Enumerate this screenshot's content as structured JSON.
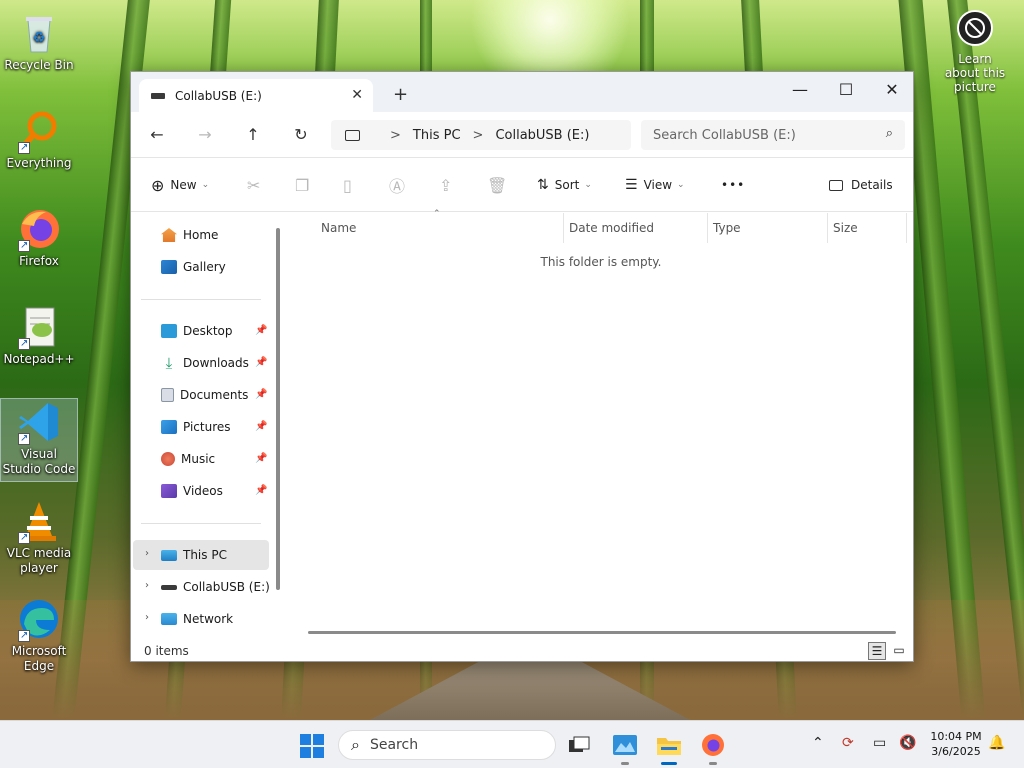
{
  "desktop": {
    "icons": [
      {
        "label": "Recycle Bin"
      },
      {
        "label": "Everything"
      },
      {
        "label": "Firefox"
      },
      {
        "label": "Notepad++"
      },
      {
        "label": "Visual Studio Code"
      },
      {
        "label": "VLC media player"
      },
      {
        "label": "Microsoft Edge"
      }
    ],
    "learn_label": "Learn about this picture"
  },
  "explorer": {
    "tab_title": "CollabUSB (E:)",
    "new_tab_glyph": "+",
    "controls": {
      "minimize": "—",
      "maximize": "☐",
      "close": "✕"
    },
    "nav": {
      "back": "←",
      "forward": "→",
      "up": "↑",
      "refresh": "↻"
    },
    "breadcrumb": [
      "This PC",
      "CollabUSB (E:)"
    ],
    "breadcrumb_sep": ">",
    "search_placeholder": "Search CollabUSB (E:)",
    "toolbar": {
      "new_label": "New",
      "sort_label": "Sort",
      "view_label": "View",
      "more_label": "•••",
      "details_label": "Details"
    },
    "sidebar": {
      "home": "Home",
      "gallery": "Gallery",
      "quick_access": [
        {
          "label": "Desktop"
        },
        {
          "label": "Downloads"
        },
        {
          "label": "Documents"
        },
        {
          "label": "Pictures"
        },
        {
          "label": "Music"
        },
        {
          "label": "Videos"
        }
      ],
      "this_pc": "This PC",
      "drive": "CollabUSB (E:)",
      "network": "Network"
    },
    "columns": [
      "Name",
      "Date modified",
      "Type",
      "Size"
    ],
    "empty_message": "This folder is empty.",
    "status": "0 items"
  },
  "taskbar": {
    "search_label": "Search",
    "time": "10:04 PM",
    "date": "3/6/2025"
  },
  "colors": {
    "accent": "#0067c0",
    "selection": "#e5e5e5",
    "window_bg": "#ffffff",
    "titlebar_bg": "#eef1f5"
  }
}
